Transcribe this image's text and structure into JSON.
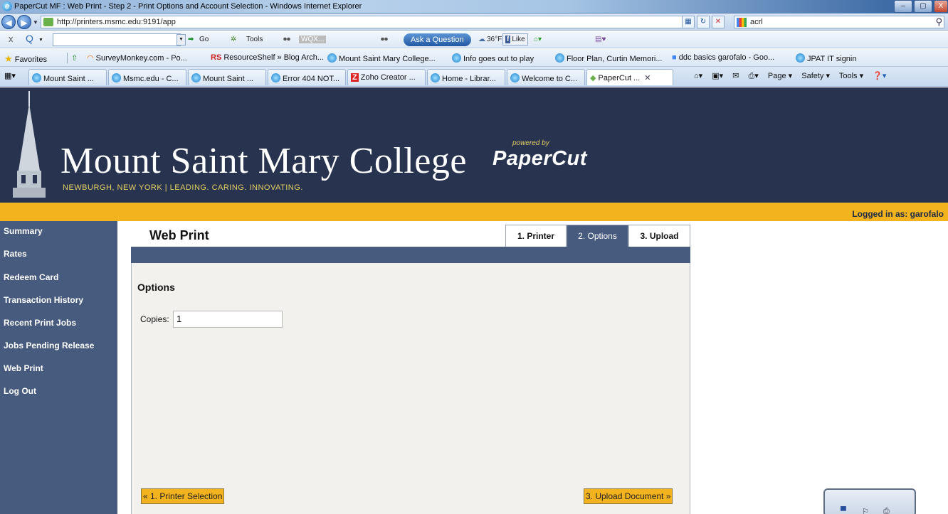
{
  "window": {
    "title": "PaperCut MF : Web Print - Step 2 - Print Options and Account Selection - Windows Internet Explorer",
    "min": "–",
    "max": "▢",
    "close": "X"
  },
  "address_bar": {
    "url": "http://printers.msmc.edu:9191/app",
    "search_value": "acrl"
  },
  "toolbar": {
    "close": "x",
    "go": "Go",
    "tools": "Tools",
    "station": "WQX...",
    "ask": "Ask a Question",
    "temp": "36°F",
    "like": "Like"
  },
  "favorites": {
    "label": "Favorites",
    "items": [
      "SurveyMonkey.com - Po...",
      "ResourceShelf » Blog Arch...",
      "Mount Saint Mary College...",
      "Info goes out to play",
      "Floor Plan, Curtin Memori...",
      "ddc basics garofalo - Goo...",
      "JPAT IT signin"
    ],
    "rs_badge": "RS"
  },
  "tabs": [
    {
      "label": "Mount Saint ..."
    },
    {
      "label": "Msmc.edu - C..."
    },
    {
      "label": "Mount Saint ..."
    },
    {
      "label": "Error 404 NOT..."
    },
    {
      "label": "Zoho Creator ..."
    },
    {
      "label": "Home - Librar..."
    },
    {
      "label": "Welcome to C..."
    },
    {
      "label": "PaperCut ..."
    }
  ],
  "command_bar": {
    "page": "Page ▾",
    "safety": "Safety ▾",
    "tools": "Tools ▾"
  },
  "header": {
    "college": "Mount Saint Mary College",
    "tagline": "NEWBURGH, NEW YORK  |  LEADING. CARING. INNOVATING.",
    "powered_by": "powered by",
    "product": "PaperCut"
  },
  "logged_in": "Logged in as:  garofalo",
  "sidebar": {
    "items": [
      "Summary",
      "Rates",
      "Redeem Card",
      "Transaction History",
      "Recent Print Jobs",
      "Jobs Pending Release",
      "Web Print",
      "Log Out"
    ]
  },
  "main": {
    "title": "Web Print",
    "steps": [
      "1. Printer",
      "2. Options",
      "3. Upload"
    ],
    "section_title": "Options",
    "copies_label": "Copies:",
    "copies_value": "1",
    "prev_button": "« 1. Printer Selection",
    "next_button": "3. Upload Document »"
  },
  "colors": {
    "header_bg": "#27334f",
    "accent_yellow": "#f3b31e",
    "nav_bg": "#465b7d",
    "panel_bg": "#f2f1ed"
  }
}
